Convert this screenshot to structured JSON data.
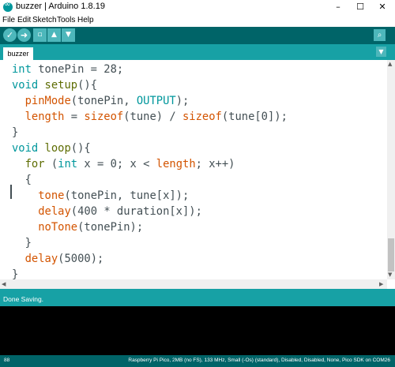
{
  "window": {
    "title": "buzzer | Arduino 1.8.19",
    "controls": {
      "minimize": "–",
      "maximize": "☐",
      "close": "✕"
    }
  },
  "menu": {
    "items": [
      "File",
      "Edit",
      "Sketch",
      "Tools",
      "Help"
    ]
  },
  "toolbar": {
    "buttons": [
      "verify-icon",
      "upload-icon",
      "new-icon",
      "open-icon",
      "save-icon"
    ],
    "serial_monitor": "serial-monitor-icon"
  },
  "tabs": [
    {
      "label": "buzzer",
      "active": true
    }
  ],
  "editor": {
    "code_lines": [
      "int tonePin = 28;",
      "void setup(){",
      "  pinMode(tonePin, OUTPUT);",
      "  length = sizeof(tune) / sizeof(tune[0]);",
      "}",
      "void loop(){",
      "  for (int x = 0; x < length; x++)",
      "  {",
      "    tone(tonePin, tune[x]);",
      "    delay(400 * duration[x]);",
      "    noTone(tonePin);",
      "  }",
      "  delay(5000);",
      "}"
    ]
  },
  "status": {
    "message": "Done Saving."
  },
  "footer": {
    "line_number": "88",
    "board_info": "Raspberry Pi Pico, 2MB (no FS), 133 MHz, Small (-Os) (standard), Disabled, Disabled, None, Pico SDK on COM26"
  },
  "colors": {
    "toolbar": "#006468",
    "accent": "#17a1a5",
    "button": "#4db7bb",
    "keyword_type": "#00979c",
    "keyword_struct": "#5e6d03",
    "function": "#d35400"
  }
}
